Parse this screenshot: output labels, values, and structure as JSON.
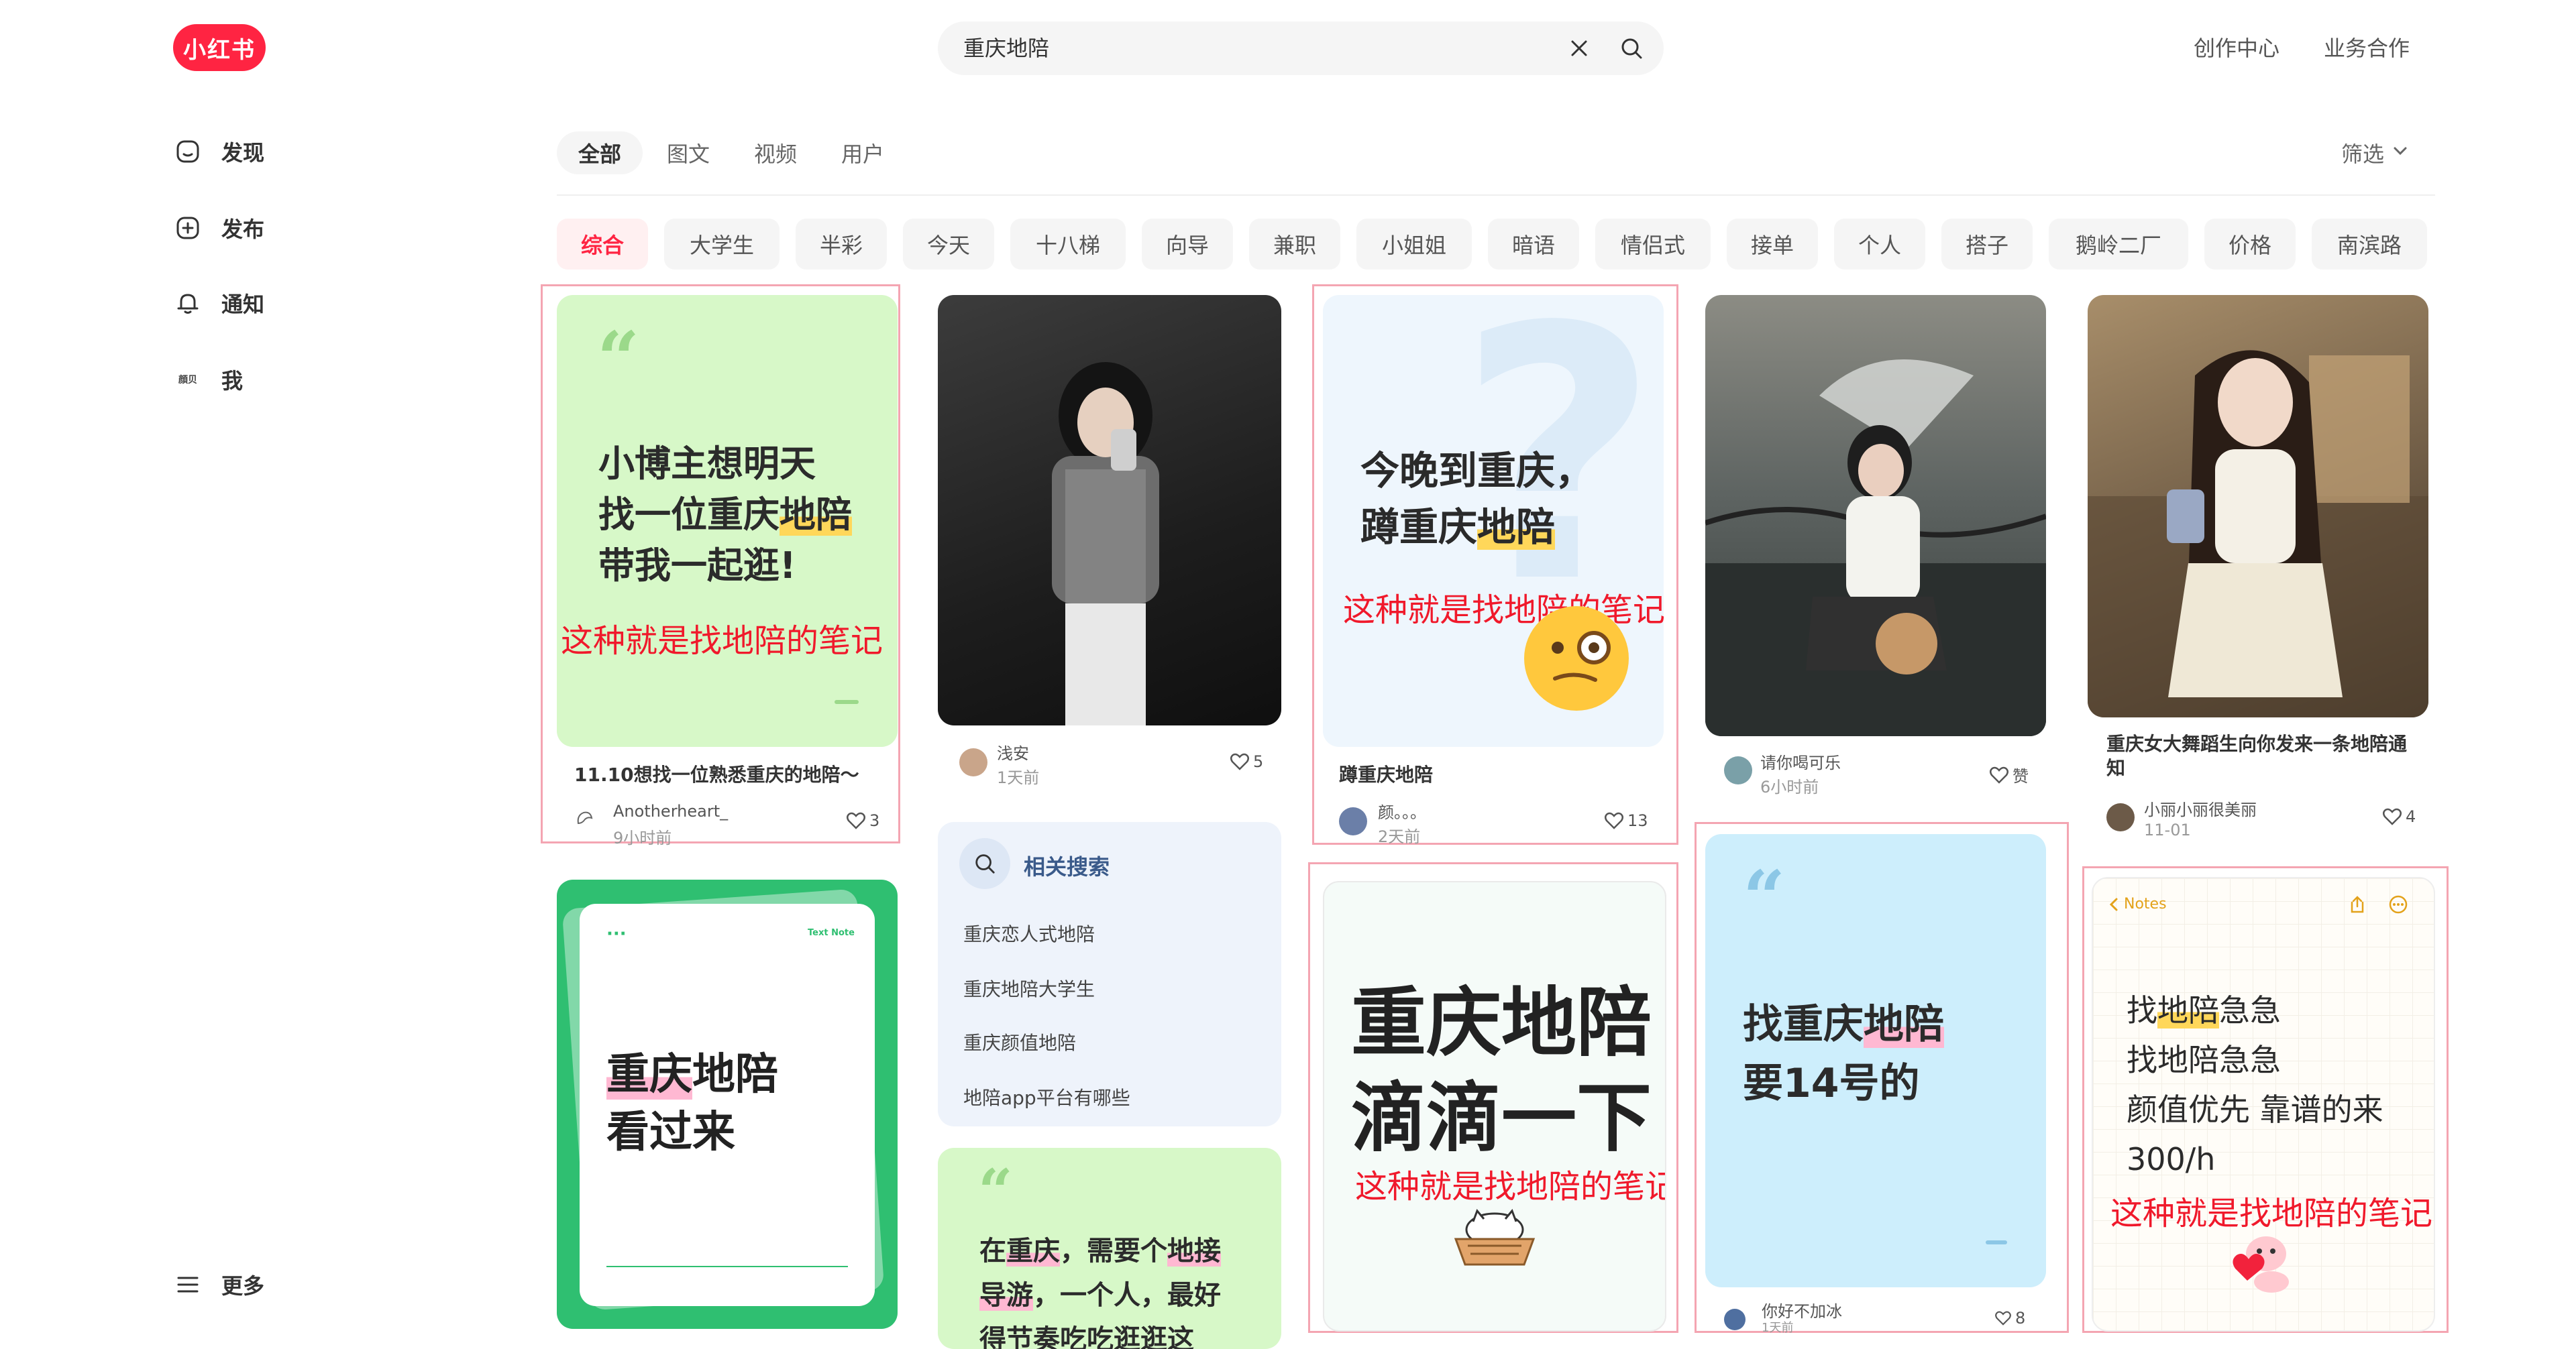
{
  "header": {
    "logo": "小红书",
    "search_value": "重庆地陪",
    "links": [
      "创作中心",
      "业务合作"
    ]
  },
  "sidebar": {
    "items": [
      {
        "label": "发现",
        "icon": "home-icon"
      },
      {
        "label": "发布",
        "icon": "plus-square-icon"
      },
      {
        "label": "通知",
        "icon": "bell-icon"
      },
      {
        "label": "我",
        "icon": "avatar-icon",
        "mini": "顔贝"
      }
    ],
    "more": "更多"
  },
  "tabs": [
    "全部",
    "图文",
    "视频",
    "用户"
  ],
  "filter_label": "筛选",
  "chips": [
    "综合",
    "大学生",
    "半彩",
    "今天",
    "十八梯",
    "向导",
    "兼职",
    "小姐姐",
    "暗语",
    "情侣式",
    "接单",
    "个人",
    "搭子",
    "鹅岭二厂",
    "价格",
    "南滨路"
  ],
  "cards": {
    "c1": {
      "lines": [
        "小博主想明天",
        "找一位重庆",
        "地陪",
        "带我一起逛!"
      ],
      "overlay": "这种就是找地陪的笔记",
      "title": "11.10想找一位熟悉重庆的地陪～",
      "author": "Anotherheart_",
      "time": "9小时前",
      "likes": "3"
    },
    "c2": {
      "author": "浅安",
      "time": "1天前",
      "likes": "5"
    },
    "c3": {
      "line1": "今晚到重庆，",
      "line2a": "蹲重庆",
      "line2b": "地陪",
      "overlay": "这种就是找地陪的笔记",
      "title": "蹲重庆地陪",
      "author": "颜。。。",
      "time": "2天前",
      "likes": "13"
    },
    "c4": {
      "author": "请你喝可乐",
      "time": "6小时前",
      "likes": "赞"
    },
    "c5": {
      "title": "重庆女大舞蹈生向你发来一条地陪通知",
      "author": "小丽小丽很美丽",
      "time": "11-01",
      "likes": "4"
    },
    "c6": {
      "badge": "Text Note",
      "line1a": "重庆",
      "line1b": "地陪",
      "line2": "看过来"
    },
    "related": {
      "title": "相关搜索",
      "items": [
        "重庆恋人式地陪",
        "重庆地陪大学生",
        "重庆颜值地陪",
        "地陪app平台有哪些"
      ]
    },
    "c7": {
      "line1a": "在",
      "line1b": "重庆",
      "line1c": "，需要个",
      "line1d": "地接",
      "line2a": "导游",
      "line2b": "，一个人，最好",
      "line3": "得节奏吃吃逛逛这"
    },
    "c8": {
      "line1": "重庆地陪",
      "line2": "滴滴一下",
      "overlay": "这种就是找地陪的笔记"
    },
    "c9": {
      "line1a": "找重庆",
      "line1b": "地陪",
      "line2": "要14号的",
      "author": "你好不加冰",
      "time": "1天前",
      "likes": "8"
    },
    "c10": {
      "notes_label": "Notes",
      "line1a": "找",
      "line1b": "地陪",
      "line1c": "急急",
      "line2": "找地陪急急",
      "line3": "颜值优先 靠谱的来",
      "line4": "300/h",
      "overlay": "这种就是找地陪的笔记"
    }
  }
}
